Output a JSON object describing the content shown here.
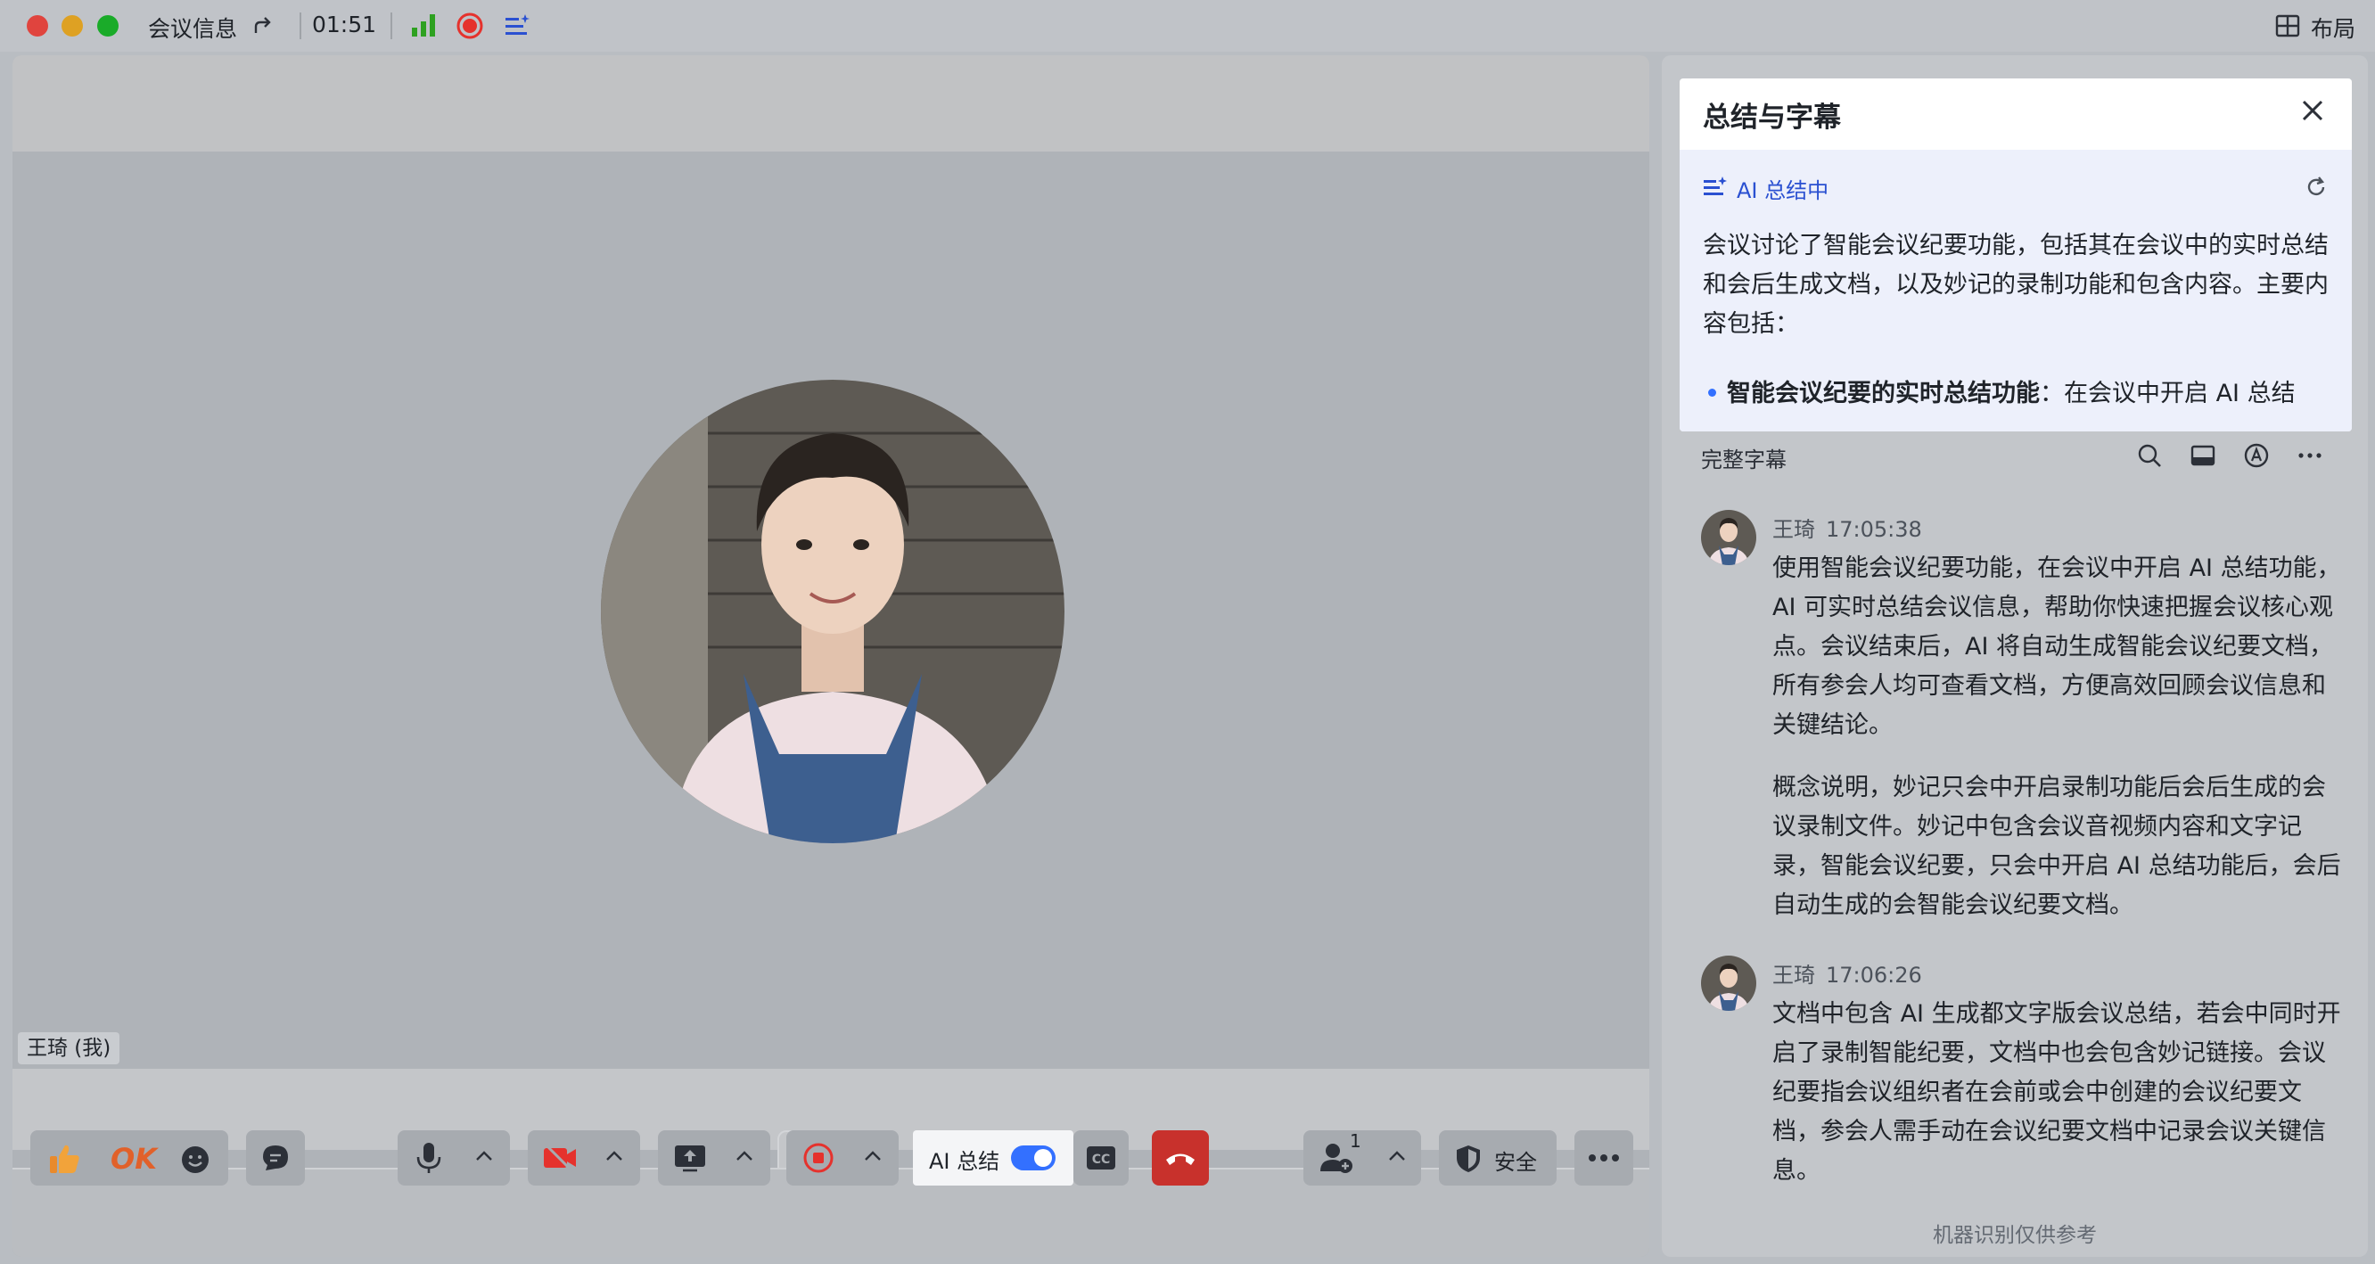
{
  "titlebar": {
    "meeting_info_label": "会议信息",
    "timer": "01:51",
    "layout_label": "布局"
  },
  "video": {
    "participant_name": "王琦 (我)"
  },
  "toolbar": {
    "ok_label": "OK",
    "ai_summary_label": "AI 总结",
    "ai_summary_enabled": true,
    "participant_count": "1",
    "security_label": "安全"
  },
  "side_panel": {
    "title": "总结与字幕",
    "ai_status": "AI 总结中",
    "ai_summary_text": "会议讨论了智能会议纪要功能，包括其在会议中的实时总结和会后生成文档，以及妙记的录制功能和包含内容。主要内容包括：",
    "ai_bullet_bold": "智能会议纪要的实时总结功能",
    "ai_bullet_rest": "：在会议中开启 AI 总结",
    "subtitles_header": "完整字幕",
    "entries": [
      {
        "speaker": "王琦",
        "time": "17:05:38",
        "paragraphs": [
          "使用智能会议纪要功能，在会议中开启 AI 总结功能，AI 可实时总结会议信息，帮助你快速把握会议核心观点。会议结束后，AI 将自动生成智能会议纪要文档，所有参会人均可查看文档，方便高效回顾会议信息和关键结论。",
          "概念说明，妙记只会中开启录制功能后会后生成的会议录制文件。妙记中包含会议音视频内容和文字记录，智能会议纪要，只会中开启 AI 总结功能后，会后自动生成的会智能会议纪要文档。"
        ]
      },
      {
        "speaker": "王琦",
        "time": "17:06:26",
        "paragraphs": [
          "文档中包含 AI 生成都文字版会议总结，若会中同时开启了录制智能纪要，文档中也会包含妙记链接。会议纪要指会议组织者在会前或会中创建的会议纪要文档，参会人需手动在会议纪要文档中记录会议关键信息。"
        ]
      }
    ],
    "footnote": "机器识别仅供参考"
  },
  "colors": {
    "accent_blue": "#3370ff",
    "ai_blue": "#2a50d1",
    "record_red": "#e5322d",
    "hangup_red": "#c8312c",
    "signal_green": "#2ea121",
    "traffic_red": "#e0443e",
    "traffic_yellow": "#dea123",
    "traffic_green": "#1aab29"
  }
}
